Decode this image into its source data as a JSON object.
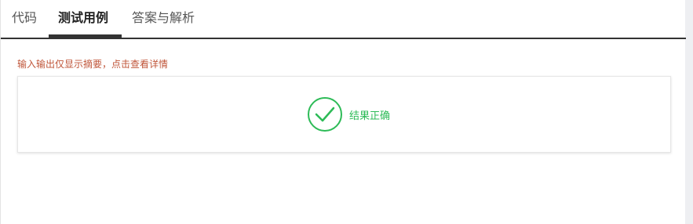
{
  "tabs": [
    {
      "label": "代码"
    },
    {
      "label": "测试用例"
    },
    {
      "label": "答案与解析"
    }
  ],
  "notice": "输入输出仅显示摘要，点击查看详情",
  "result": {
    "text": "结果正确",
    "icon": "check-circle-icon",
    "color": "#2dbb57"
  }
}
